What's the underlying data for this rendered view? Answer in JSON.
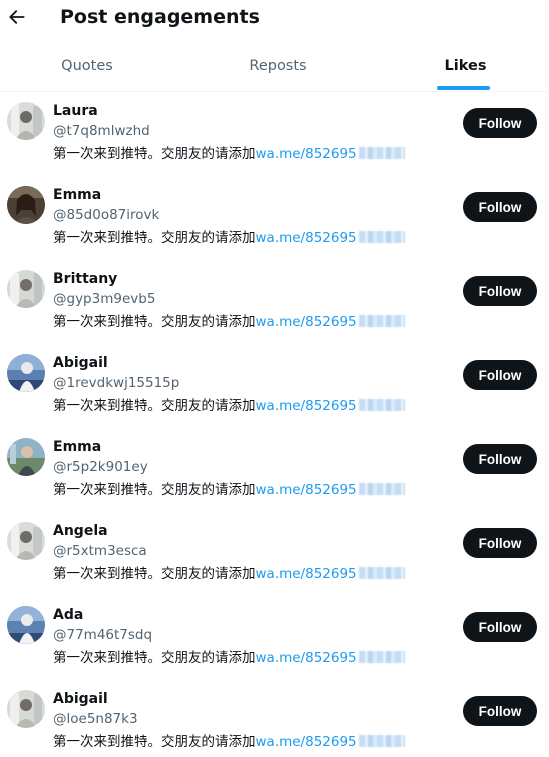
{
  "header": {
    "title": "Post engagements",
    "back_icon": "arrow-left-icon"
  },
  "tabs": [
    {
      "label": "Quotes",
      "active": false
    },
    {
      "label": "Reposts",
      "active": false
    },
    {
      "label": "Likes",
      "active": true
    }
  ],
  "colors": {
    "accent": "#1d9bf0",
    "text": "#0f1419",
    "secondary": "#536471",
    "button": "#0f1419"
  },
  "users": [
    {
      "name": "Laura",
      "handle": "@t7q8mlwzhd",
      "bio_text": "第一次来到推特。交朋友的请添加",
      "bio_link": "wa.me/852695",
      "follow_label": "Follow"
    },
    {
      "name": "Emma",
      "handle": "@85d0o87irovk",
      "bio_text": "第一次来到推特。交朋友的请添加",
      "bio_link": "wa.me/852695",
      "follow_label": "Follow"
    },
    {
      "name": "Brittany",
      "handle": "@gyp3m9evb5",
      "bio_text": "第一次来到推特。交朋友的请添加",
      "bio_link": "wa.me/852695",
      "follow_label": "Follow"
    },
    {
      "name": "Abigail",
      "handle": "@1revdkwj15515p",
      "bio_text": "第一次来到推特。交朋友的请添加",
      "bio_link": "wa.me/852695",
      "follow_label": "Follow"
    },
    {
      "name": "Emma",
      "handle": "@r5p2k901ey",
      "bio_text": "第一次来到推特。交朋友的请添加",
      "bio_link": "wa.me/852695",
      "follow_label": "Follow"
    },
    {
      "name": "Angela",
      "handle": "@r5xtm3esca",
      "bio_text": "第一次来到推特。交朋友的请添加",
      "bio_link": "wa.me/852695",
      "follow_label": "Follow"
    },
    {
      "name": "Ada",
      "handle": "@77m46t7sdq",
      "bio_text": "第一次来到推特。交朋友的请添加",
      "bio_link": "wa.me/852695",
      "follow_label": "Follow"
    },
    {
      "name": "Abigail",
      "handle": "@loe5n87k3",
      "bio_text": "第一次来到推特。交朋友的请添加",
      "bio_link": "wa.me/852695",
      "follow_label": "Follow"
    }
  ]
}
